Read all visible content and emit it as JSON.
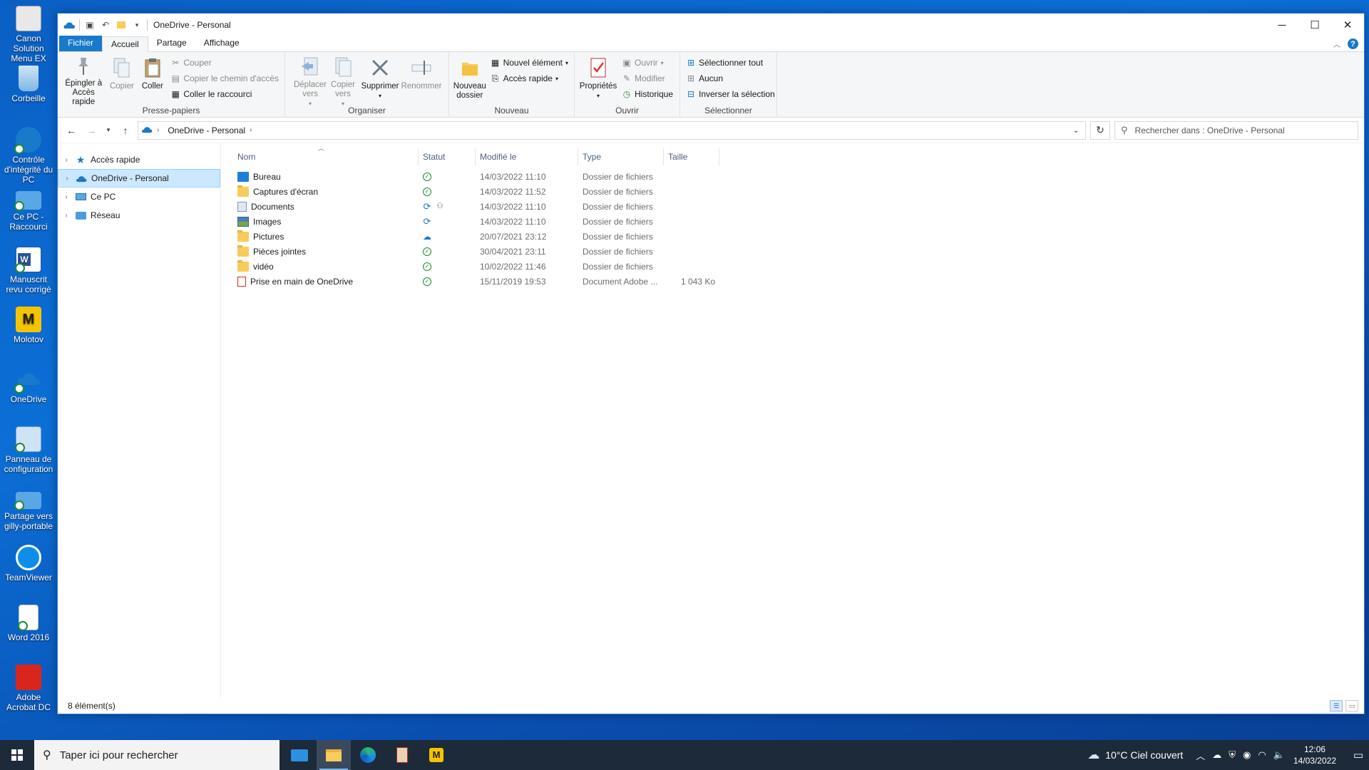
{
  "desktop": {
    "icons": [
      {
        "label": "Canon Solution Menu EX"
      },
      {
        "label": "Corbeille"
      },
      {
        "label": "Contrôle d'intégrité du PC"
      },
      {
        "label": "Ce PC - Raccourci"
      },
      {
        "label": "Manuscrit revu corrigé"
      },
      {
        "label": "Molotov"
      },
      {
        "label": "OneDrive"
      },
      {
        "label": "Panneau de configuration"
      },
      {
        "label": "Partage vers gilly-portable"
      },
      {
        "label": "TeamViewer"
      },
      {
        "label": "Word 2016"
      },
      {
        "label": "Adobe Acrobat DC"
      }
    ]
  },
  "window": {
    "title": "OneDrive - Personal",
    "tabs": [
      {
        "label": "Fichier"
      },
      {
        "label": "Accueil"
      },
      {
        "label": "Partage"
      },
      {
        "label": "Affichage"
      }
    ],
    "ribbon": {
      "clipboard": {
        "title": "Presse-papiers",
        "pin": "Épingler à Accès rapide",
        "copy": "Copier",
        "paste": "Coller",
        "cut": "Couper",
        "copy_path": "Copier le chemin d'accès",
        "paste_shortcut": "Coller le raccourci"
      },
      "organize": {
        "title": "Organiser",
        "move_to": "Déplacer vers",
        "copy_to": "Copier vers",
        "delete": "Supprimer",
        "rename": "Renommer"
      },
      "new": {
        "title": "Nouveau",
        "new_folder": "Nouveau dossier",
        "new_item": "Nouvel élément",
        "quick_access": "Accès rapide"
      },
      "open": {
        "title": "Ouvrir",
        "properties": "Propriétés",
        "open": "Ouvrir",
        "edit": "Modifier",
        "history": "Historique"
      },
      "select": {
        "title": "Sélectionner",
        "select_all": "Sélectionner tout",
        "none": "Aucun",
        "invert": "Inverser la sélection"
      }
    },
    "address": {
      "crumb": "OneDrive - Personal",
      "search_placeholder": "Rechercher dans : OneDrive - Personal"
    },
    "nav": [
      {
        "label": "Accès rapide"
      },
      {
        "label": "OneDrive - Personal"
      },
      {
        "label": "Ce PC"
      },
      {
        "label": "Réseau"
      }
    ],
    "columns": {
      "name": "Nom",
      "status": "Statut",
      "modified": "Modifié le",
      "type": "Type",
      "size": "Taille"
    },
    "files": [
      {
        "name": "Bureau",
        "status": "ok",
        "modified": "14/03/2022 11:10",
        "type": "Dossier de fichiers",
        "size": ""
      },
      {
        "name": "Captures d'écran",
        "status": "ok",
        "modified": "14/03/2022 11:52",
        "type": "Dossier de fichiers",
        "size": ""
      },
      {
        "name": "Documents",
        "status": "sync-shared",
        "modified": "14/03/2022 11:10",
        "type": "Dossier de fichiers",
        "size": ""
      },
      {
        "name": "Images",
        "status": "sync",
        "modified": "14/03/2022 11:10",
        "type": "Dossier de fichiers",
        "size": ""
      },
      {
        "name": "Pictures",
        "status": "cloud",
        "modified": "20/07/2021 23:12",
        "type": "Dossier de fichiers",
        "size": ""
      },
      {
        "name": "Pièces jointes",
        "status": "ok",
        "modified": "30/04/2021 23:11",
        "type": "Dossier de fichiers",
        "size": ""
      },
      {
        "name": "vidéo",
        "status": "ok",
        "modified": "10/02/2022 11:46",
        "type": "Dossier de fichiers",
        "size": ""
      },
      {
        "name": "Prise en main de OneDrive",
        "status": "ok",
        "modified": "15/11/2019 19:53",
        "type": "Document Adobe ...",
        "size": "1 043 Ko"
      }
    ],
    "status_text": "8 élément(s)"
  },
  "taskbar": {
    "search_placeholder": "Taper ici pour rechercher",
    "weather": "10°C  Ciel couvert",
    "time": "12:06",
    "date": "14/03/2022"
  }
}
